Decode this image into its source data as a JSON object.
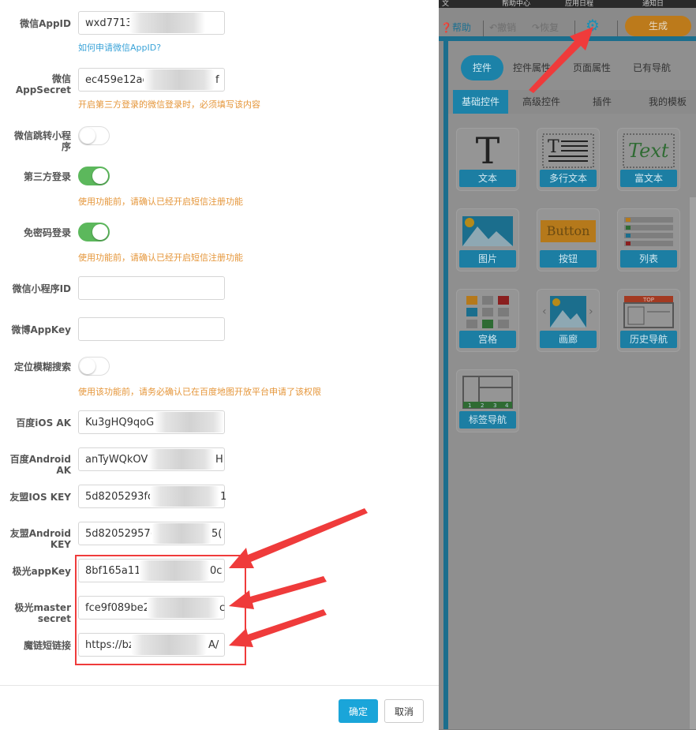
{
  "form": {
    "wechat_appid": {
      "label": "微信AppID",
      "value": "wxd7713",
      "link": "如何申请微信AppID?"
    },
    "wechat_secret": {
      "label_line1": "微信",
      "label_line2": "AppSecret",
      "value": "ec459e12ac",
      "tail": "f",
      "hint": "开启第三方登录的微信登录时，必须填写该内容"
    },
    "mini_jump": {
      "label_line1": "微信跳转小程",
      "label_line2": "序",
      "on": false
    },
    "third_login": {
      "label": "第三方登录",
      "on": true,
      "hint": "使用功能前，请确认已经开启短信注册功能"
    },
    "nopwd_login": {
      "label": "免密码登录",
      "on": true,
      "hint": "使用功能前，请确认已经开启短信注册功能"
    },
    "mini_id": {
      "label": "微信小程序ID",
      "value": ""
    },
    "weibo_key": {
      "label": "微博AppKey",
      "value": ""
    },
    "fuzzy_search": {
      "label": "定位模糊搜索",
      "on": false,
      "hint": "使用该功能前，请务必确认已在百度地图开放平台申请了该权限"
    },
    "baidu_ios": {
      "label": "百度iOS AK",
      "value": "Ku3gHQ9qoGS"
    },
    "baidu_android": {
      "label_line1": "百度Android",
      "label_line2": "AK",
      "value": "anTyWQkOV",
      "tail": "H"
    },
    "umeng_ios": {
      "label": "友盟IOS KEY",
      "value": "5d8205293fc",
      "tail": "1"
    },
    "umeng_android": {
      "label_line1": "友盟Android",
      "label_line2": "KEY",
      "value": "5d82052957(",
      "tail": "5("
    },
    "jpush_appkey": {
      "label": "极光appKey",
      "value": "8bf165a114",
      "tail": "0c"
    },
    "jpush_secret": {
      "label_line1": "极光master",
      "label_line2": "secret",
      "value": "fce9f089be2",
      "tail": "c"
    },
    "magic_link": {
      "label": "魔链短链接",
      "value": "https://bz",
      "tail": "A/"
    },
    "ok_label": "确定",
    "cancel_label": "取消"
  },
  "editor": {
    "top_strip": [
      "文",
      "帮助中心",
      "应用日程",
      "通知日"
    ],
    "help": "帮助",
    "undo": "撤销",
    "redo": "恢复",
    "generate": "生成",
    "tabs": [
      "控件",
      "控件属性",
      "页面属性",
      "已有导航"
    ],
    "subtabs": [
      "基础控件",
      "高级控件",
      "插件",
      "我的模板"
    ],
    "tiles": [
      "文本",
      "多行文本",
      "富文本",
      "图片",
      "按钮",
      "列表",
      "宫格",
      "画廊",
      "历史导航",
      "标签导航"
    ],
    "button_glyph": "Button",
    "text_glyph": "Text",
    "top_badge": "TOP",
    "tab_nums": [
      "1",
      "2",
      "3",
      "4"
    ]
  },
  "colors": {
    "accent": "#1aa5d9",
    "toggle_on": "#5cb85c",
    "hint": "#e5963a",
    "annotation": "#ef3b3b"
  }
}
